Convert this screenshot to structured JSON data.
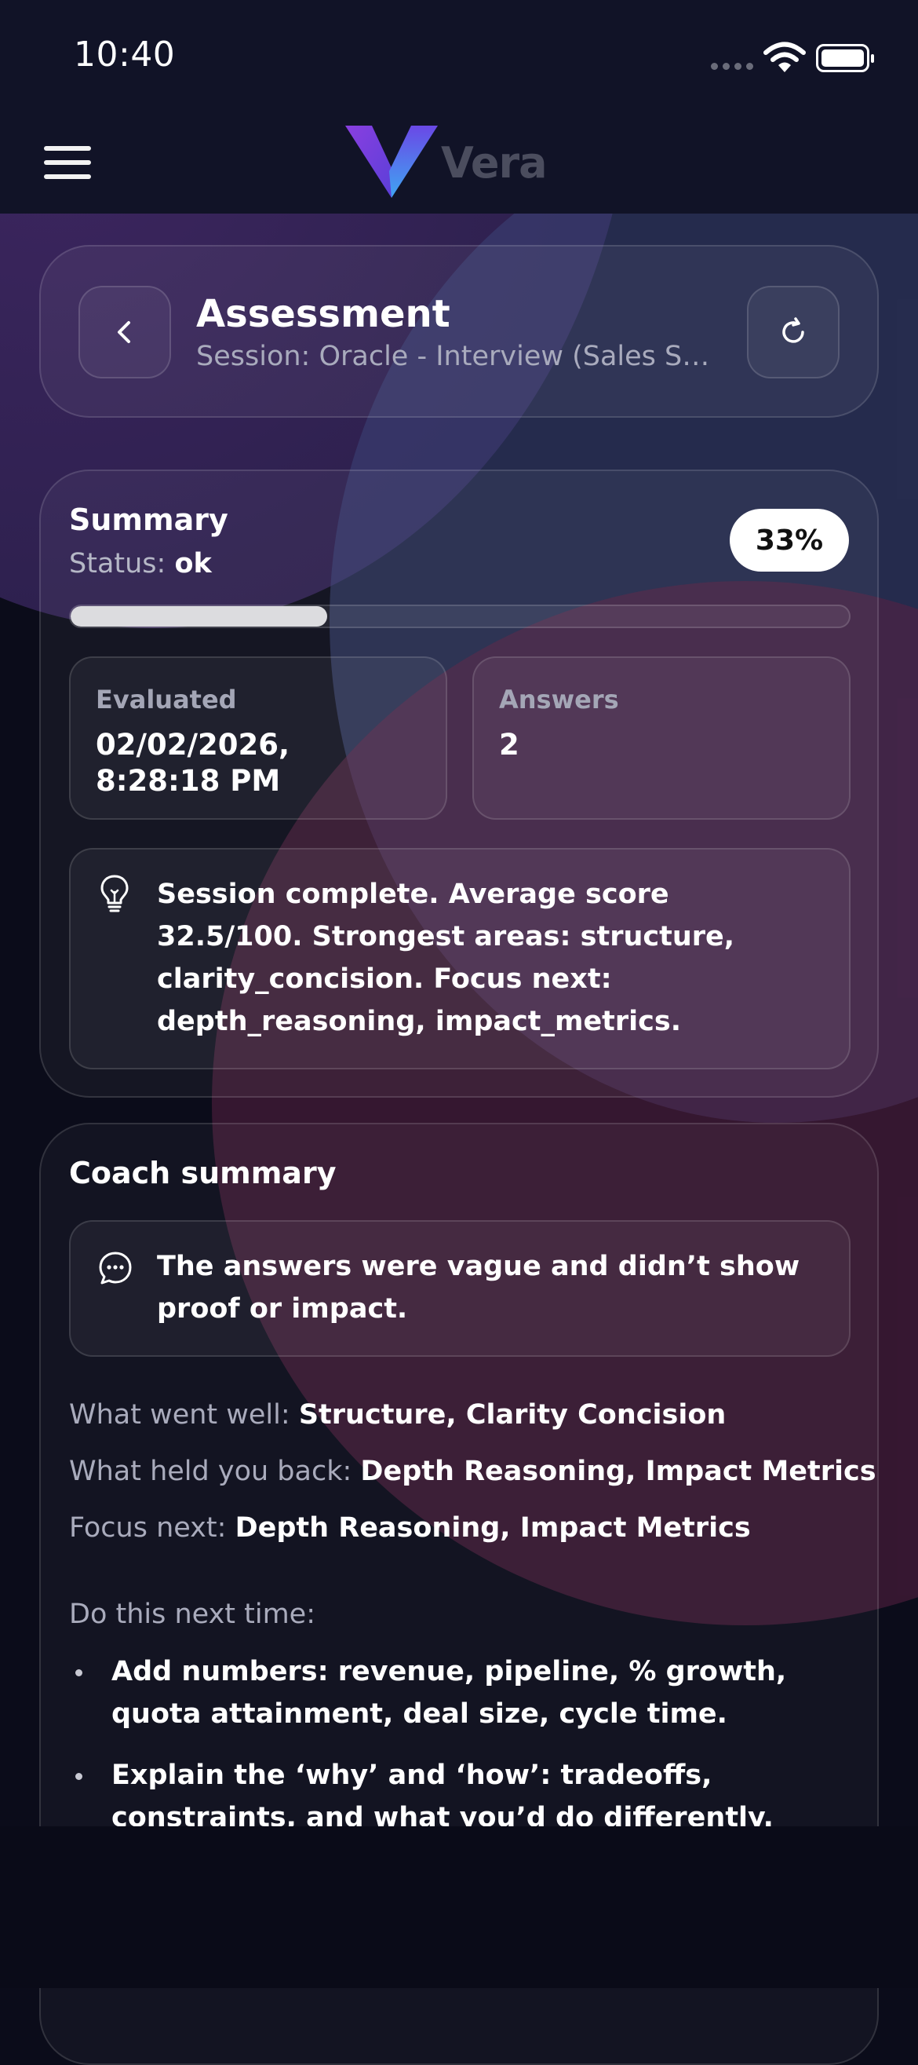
{
  "status_bar": {
    "time": "10:40"
  },
  "app": {
    "name": "Vera"
  },
  "header": {
    "title": "Assessment",
    "subtitle": "Session: Oracle - Interview (Sales Skil..."
  },
  "summary": {
    "title": "Summary",
    "status_label": "Status:",
    "status_value": "ok",
    "score_percent": "33%",
    "progress_fraction": 0.33,
    "evaluated_label": "Evaluated",
    "evaluated_value": "02/02/2026, 8:28:18 PM",
    "answers_label": "Answers",
    "answers_value": "2",
    "insight": "Session complete. Average score 32.5/100. Strongest areas: structure, clarity_concision. Focus next: depth_reasoning, impact_metrics."
  },
  "coach": {
    "title": "Coach summary",
    "quote": "The answers were vague and didn’t show proof or impact.",
    "went_well_label": "What went well:",
    "went_well_value": "Structure, Clarity Concision",
    "held_back_label": "What held you back:",
    "held_back_value": "Depth Reasoning, Impact Metrics",
    "focus_label": "Focus next:",
    "focus_value": "Depth Reasoning, Impact Metrics",
    "next_time_label": "Do this next time:",
    "tips": [
      "Add numbers: revenue, pipeline, % growth, quota attainment, deal size, cycle time.",
      "Explain the ‘why’ and ‘how’: tradeoffs, constraints, and what you’d do differently."
    ]
  },
  "icons": {
    "menu": "menu-icon",
    "back": "chevron-left-icon",
    "refresh": "refresh-icon",
    "insight": "lightbulb-icon",
    "quote": "chat-bubble-icon"
  },
  "colors": {
    "background": "#0b0c1a",
    "logo_gradient_start": "#7b3fe0",
    "logo_gradient_end": "#3fa0f0",
    "badge_bg": "#ffffff",
    "progress_fill": "#dcdcdf"
  }
}
